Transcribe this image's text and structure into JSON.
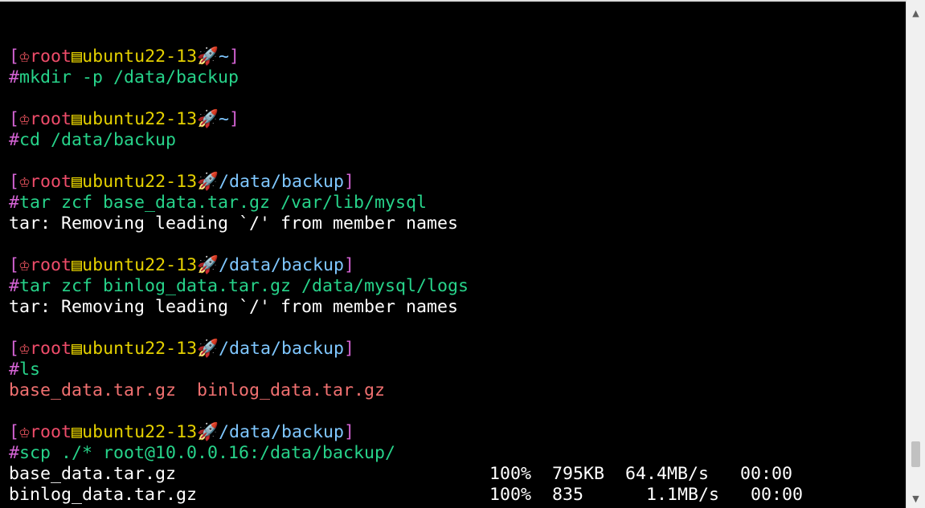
{
  "prompt_icons": {
    "crown": "♔",
    "host": "▤",
    "rocket": "🚀"
  },
  "blocks": [
    {
      "user": "root",
      "host": "ubuntu22-13",
      "cwd": "~",
      "command": "mkdir -p /data/backup",
      "output": []
    },
    {
      "user": "root",
      "host": "ubuntu22-13",
      "cwd": "~",
      "command": "cd /data/backup",
      "output": []
    },
    {
      "user": "root",
      "host": "ubuntu22-13",
      "cwd": "/data/backup",
      "command": "tar zcf base_data.tar.gz /var/lib/mysql",
      "output": [
        {
          "kind": "out",
          "text": "tar: Removing leading `/' from member names"
        }
      ]
    },
    {
      "user": "root",
      "host": "ubuntu22-13",
      "cwd": "/data/backup",
      "command": "tar zcf binlog_data.tar.gz /data/mysql/logs",
      "output": [
        {
          "kind": "out",
          "text": "tar: Removing leading `/' from member names"
        }
      ]
    },
    {
      "user": "root",
      "host": "ubuntu22-13",
      "cwd": "/data/backup",
      "command": "ls",
      "output": [
        {
          "kind": "file",
          "text": "base_data.tar.gz  binlog_data.tar.gz"
        }
      ]
    },
    {
      "user": "root",
      "host": "ubuntu22-13",
      "cwd": "/data/backup",
      "command": "scp ./* root@10.0.0.16:/data/backup/",
      "output": [
        {
          "kind": "out",
          "text": "base_data.tar.gz                              100%  795KB  64.4MB/s   00:00"
        },
        {
          "kind": "out",
          "text": "binlog_data.tar.gz                            100%  835      1.1MB/s   00:00"
        }
      ]
    }
  ],
  "scrollbar": {
    "up_arrow": "▲",
    "down_arrow": "▼",
    "position_fraction": 0.95
  }
}
